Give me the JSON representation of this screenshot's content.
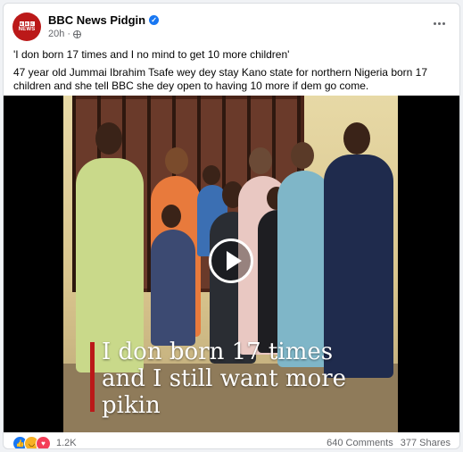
{
  "post": {
    "page_name": "BBC News Pidgin",
    "time": "20h",
    "headline": "'I don born 17 times and I no mind to get 10 more children'",
    "body": "47 year old Jummai Ibrahim Tsafe wey dey stay Kano state for northern Nigeria born 17 children and she tell BBC she dey open to having 10 more if dem go come.",
    "avatar_logo": {
      "blocks": [
        "B",
        "B",
        "C"
      ],
      "sub": "NEWS"
    }
  },
  "video": {
    "caption_lines": [
      "I don born 17 times",
      "and I still want more",
      "pikin"
    ],
    "play_icon": "play-icon"
  },
  "footer": {
    "reaction_count": "1.2K",
    "comments": "640 Comments",
    "shares": "377 Shares",
    "reaction_icons": [
      "like-icon",
      "haha-icon",
      "love-icon"
    ]
  },
  "colors": {
    "brand_red": "#bb1919",
    "verified_blue": "#1877f2",
    "muted_text": "#65676b"
  }
}
